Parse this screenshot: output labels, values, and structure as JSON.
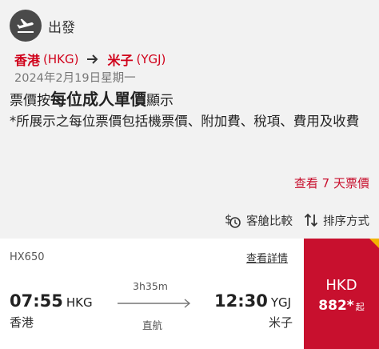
{
  "departure": {
    "header_label": "出發",
    "from_city": "香港",
    "from_code": "(HKG)",
    "to_city": "米子",
    "to_code": "(YGJ)",
    "date": "2024年2月19日星期一"
  },
  "notice": {
    "prefix": "票價按",
    "emphasis": "每位成人單價",
    "suffix": "顯示",
    "note": "*所展示之每位票價包括機票價、附加費、稅項、費用及收費"
  },
  "view_7_days_label": "查看 7 天票價",
  "tools": {
    "compare_label": "客艙比較",
    "sort_label": "排序方式"
  },
  "flight": {
    "number": "HX650",
    "details_label": "查看詳情",
    "depart_time": "07:55",
    "depart_code": "HKG",
    "depart_city": "香港",
    "duration": "3h35m",
    "stops": "直航",
    "arrive_time": "12:30",
    "arrive_code": "YGJ",
    "arrive_city": "米子",
    "price_currency": "HKD",
    "price_amount": "882*",
    "price_from": "起"
  },
  "colors": {
    "accent_red": "#c8102e",
    "corner_yellow": "#f3b400"
  }
}
